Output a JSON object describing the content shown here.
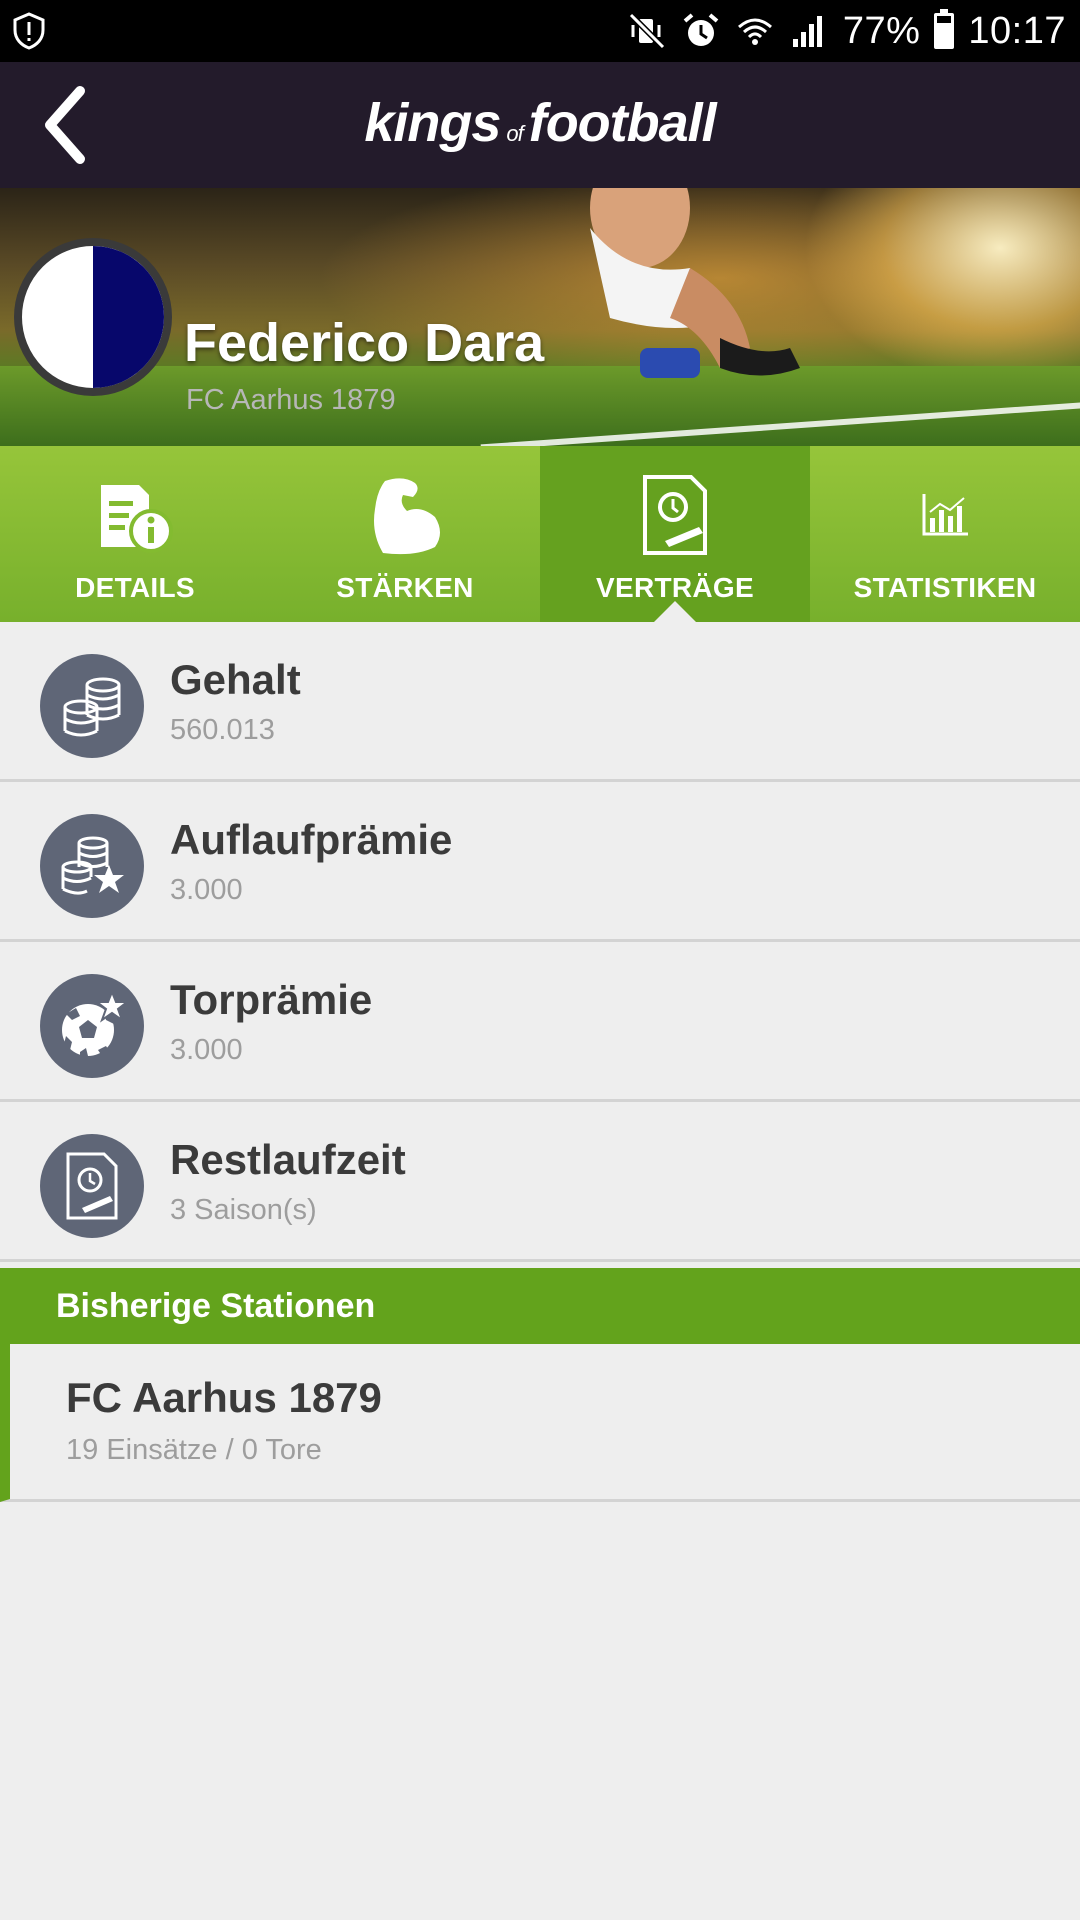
{
  "status_bar": {
    "battery_text": "77%",
    "battery_level": 0.77,
    "time": "10:17",
    "icons": [
      "shield-alert-icon",
      "mute-vibrate-icon",
      "alarm-icon",
      "wifi-icon",
      "signal-icon",
      "battery-icon"
    ]
  },
  "app_bar": {
    "logo_part1": "kings",
    "logo_part2": "of",
    "logo_part3": "football"
  },
  "player": {
    "name": "Federico Dara",
    "club": "FC Aarhus 1879"
  },
  "tabs": [
    {
      "label": "DETAILS",
      "icon": "details-icon",
      "active": false
    },
    {
      "label": "STÄRKEN",
      "icon": "strength-icon",
      "active": false
    },
    {
      "label": "VERTRÄGE",
      "icon": "contract-icon",
      "active": true
    },
    {
      "label": "STATISTIKEN",
      "icon": "statistics-icon",
      "active": false
    }
  ],
  "contract": [
    {
      "title": "Gehalt",
      "value": "560.013",
      "icon": "coins-icon"
    },
    {
      "title": "Auflaufprämie",
      "value": "3.000",
      "icon": "coins-star-icon"
    },
    {
      "title": "Torprämie",
      "value": "3.000",
      "icon": "ball-star-icon"
    },
    {
      "title": "Restlaufzeit",
      "value": "3 Saison(s)",
      "icon": "contract-clock-icon"
    }
  ],
  "stations": {
    "heading": "Bisherige Stationen",
    "items": [
      {
        "club": "FC Aarhus 1879",
        "stats": "19 Einsätze / 0 Tore"
      }
    ]
  },
  "colors": {
    "app_bar": "#231b2b",
    "tab_green": "#77b02c",
    "tab_active": "#65a11f",
    "section_green": "#63a31c",
    "icon_circle": "#5f6677"
  }
}
